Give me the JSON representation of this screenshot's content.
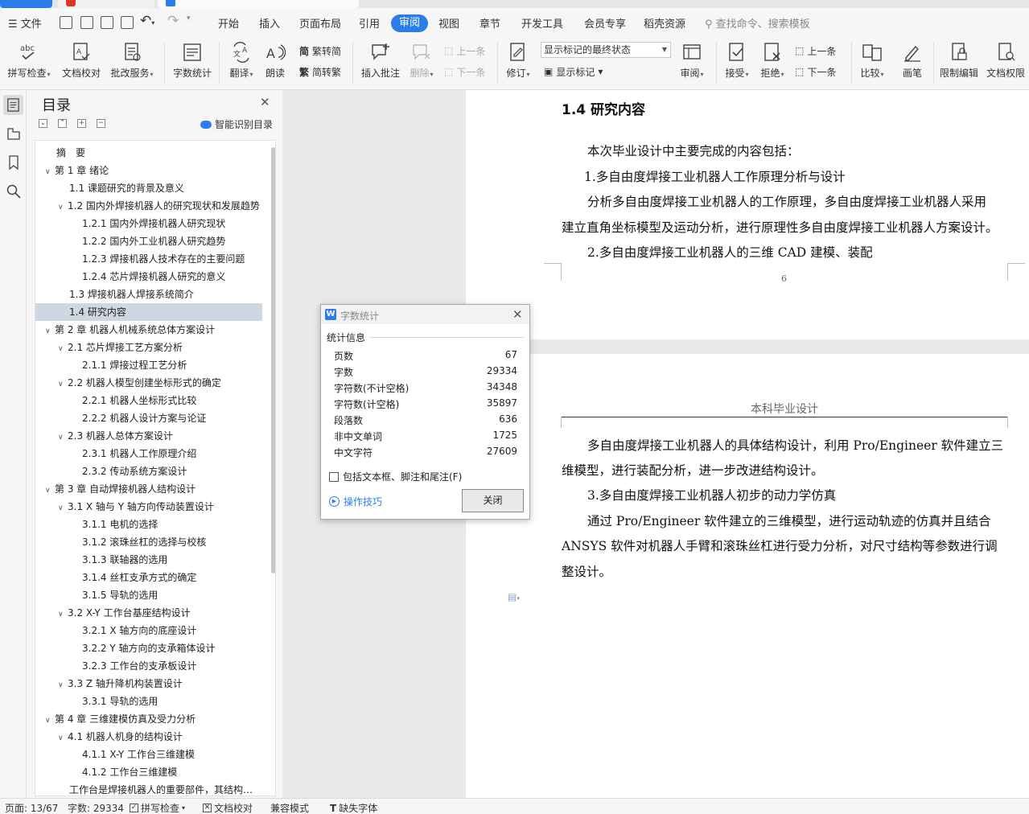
{
  "menu": {
    "file_label": "文件",
    "tabs": [
      "开始",
      "插入",
      "页面布局",
      "引用",
      "审阅",
      "视图",
      "章节",
      "开发工具",
      "会员专享",
      "稻壳资源"
    ],
    "active_tab": "审阅",
    "search_placeholder": "查找命令、搜索模板"
  },
  "ribbon": {
    "spell_check": "拼写检查",
    "doc_proofread": "文档校对",
    "batch_service": "批改服务",
    "word_count": "字数统计",
    "translate": "翻译",
    "read_aloud": "朗读",
    "trad_to_simp": "繁转简",
    "simp_to_trad": "简转繁",
    "insert_comment": "插入批注",
    "delete": "删除",
    "prev_item": "上一条",
    "next_item": "下一条",
    "revise": "修订",
    "show_markup_state": "显示标记的最终状态",
    "show_markup": "显示标记",
    "review": "审阅",
    "accept": "接受",
    "reject": "拒绝",
    "accept_prev": "上一条",
    "accept_next": "下一条",
    "compare": "比较",
    "pen": "画笔",
    "restrict_edit": "限制编辑",
    "doc_permission": "文档权限"
  },
  "toc": {
    "title": "目录",
    "smart_identify": "智能识别目录",
    "items": [
      {
        "label": "摘　要",
        "level": 0,
        "toggle": ""
      },
      {
        "label": "第 1 章  绪论",
        "level": 0,
        "toggle": "v"
      },
      {
        "label": "1.1  课题研究的背景及意义",
        "level": 1,
        "toggle": ""
      },
      {
        "label": "1.2  国内外焊接机器人的研究现状和发展趋势",
        "level": 1,
        "toggle": "v"
      },
      {
        "label": "1.2.1  国内外焊接机器人研究现状",
        "level": 2,
        "toggle": ""
      },
      {
        "label": "1.2.2  国内外工业机器人研究趋势",
        "level": 2,
        "toggle": ""
      },
      {
        "label": "1.2.3  焊接机器人技术存在的主要问题",
        "level": 2,
        "toggle": ""
      },
      {
        "label": "1.2.4  芯片焊接机器人研究的意义",
        "level": 2,
        "toggle": ""
      },
      {
        "label": "1.3  焊接机器人焊接系统简介",
        "level": 1,
        "toggle": ""
      },
      {
        "label": "1.4  研究内容",
        "level": 1,
        "toggle": "",
        "selected": true
      },
      {
        "label": "第 2 章  机器人机械系统总体方案设计",
        "level": 0,
        "toggle": "v"
      },
      {
        "label": "2.1  芯片焊接工艺方案分析",
        "level": 1,
        "toggle": "v"
      },
      {
        "label": "2.1.1  焊接过程工艺分析",
        "level": 2,
        "toggle": ""
      },
      {
        "label": "2.2  机器人模型创建坐标形式的确定",
        "level": 1,
        "toggle": "v"
      },
      {
        "label": "2.2.1  机器人坐标形式比较",
        "level": 2,
        "toggle": ""
      },
      {
        "label": "2.2.2  机器人设计方案与论证",
        "level": 2,
        "toggle": ""
      },
      {
        "label": "2.3  机器人总体方案设计",
        "level": 1,
        "toggle": "v"
      },
      {
        "label": "2.3.1 机器人工作原理介绍",
        "level": 2,
        "toggle": ""
      },
      {
        "label": "2.3.2  传动系统方案设计",
        "level": 2,
        "toggle": ""
      },
      {
        "label": "第 3 章    自动焊接机器人结构设计",
        "level": 0,
        "toggle": "v"
      },
      {
        "label": "3.1 X 轴与 Y 轴方向传动装置设计",
        "level": 1,
        "toggle": "v"
      },
      {
        "label": "3.1.1  电机的选择",
        "level": 2,
        "toggle": ""
      },
      {
        "label": "3.1.2 滚珠丝杠的选择与校核",
        "level": 2,
        "toggle": ""
      },
      {
        "label": "3.1.3  联轴器的选用",
        "level": 2,
        "toggle": ""
      },
      {
        "label": "3.1.4  丝杠支承方式的确定",
        "level": 2,
        "toggle": ""
      },
      {
        "label": "3.1.5  导轨的选用",
        "level": 2,
        "toggle": ""
      },
      {
        "label": "3.2    X-Y 工作台基座结构设计",
        "level": 1,
        "toggle": "v"
      },
      {
        "label": "3.2.1    X 轴方向的底座设计",
        "level": 2,
        "toggle": ""
      },
      {
        "label": "3.2.2    Y 轴方向的支承箱体设计",
        "level": 2,
        "toggle": ""
      },
      {
        "label": "3.2.3    工作台的支承板设计",
        "level": 2,
        "toggle": ""
      },
      {
        "label": "3.3    Z 轴升降机构装置设计",
        "level": 1,
        "toggle": "v"
      },
      {
        "label": "3.3.1  导轨的选用",
        "level": 2,
        "toggle": ""
      },
      {
        "label": "第 4 章  三维建模仿真及受力分析",
        "level": 0,
        "toggle": "v"
      },
      {
        "label": "4.1  机器人机身的结构设计",
        "level": 1,
        "toggle": "v"
      },
      {
        "label": "4.1.1    X-Y 工作台三维建模",
        "level": 2,
        "toggle": ""
      },
      {
        "label": "4.1.2    工作台三维建模",
        "level": 2,
        "toggle": ""
      },
      {
        "label": "工作台是焊接机器人的重要部件，其结构设计直接影响",
        "level": 1,
        "toggle": ""
      }
    ]
  },
  "page1": {
    "heading": "1.4  研究内容",
    "lines": [
      "本次毕业设计中主要完成的内容包括：",
      "1.多自由度焊接工业机器人工作原理分析与设计",
      "分析多自由度焊接工业机器人的工作原理，多自由度焊接工业机器人采用",
      "建立直角坐标模型及运动分析，进行原理性多自由度焊接工业机器人方案设计。",
      "2.多自由度焊接工业机器人的三维 CAD 建模、装配"
    ],
    "page_number": "6"
  },
  "page2": {
    "header": "本科毕业设计",
    "lines": [
      "多自由度焊接工业机器人的具体结构设计，利用 Pro/Engineer 软件建立三",
      "维模型，进行装配分析，进一步改进结构设计。",
      "3.多自由度焊接工业机器人初步的动力学仿真",
      "通过 Pro/Engineer 软件建立的三维模型，进行运动轨迹的仿真并且结合",
      "ANSYS 软件对机器人手臂和滚珠丝杠进行受力分析，对尺寸结构等参数进行调",
      "整设计。"
    ]
  },
  "dialog": {
    "title": "字数统计",
    "section": "统计信息",
    "stats": [
      {
        "label": "页数",
        "value": "67"
      },
      {
        "label": "字数",
        "value": "29334"
      },
      {
        "label": "字符数(不计空格)",
        "value": "34348"
      },
      {
        "label": "字符数(计空格)",
        "value": "35897"
      },
      {
        "label": "段落数",
        "value": "636"
      },
      {
        "label": "非中文单词",
        "value": "1725"
      },
      {
        "label": "中文字符",
        "value": "27609"
      }
    ],
    "include_label": "包括文本框、脚注和尾注(F)",
    "tips_label": "操作技巧",
    "close_label": "关闭"
  },
  "status": {
    "page": "页面: 13/67",
    "words": "字数: 29334",
    "spell": "拼写检查",
    "proofread": "文档校对",
    "compat": "兼容模式",
    "missing_font": "缺失字体"
  },
  "colors": {
    "accent": "#2b7de9",
    "selected_row": "#cfd7e3"
  }
}
